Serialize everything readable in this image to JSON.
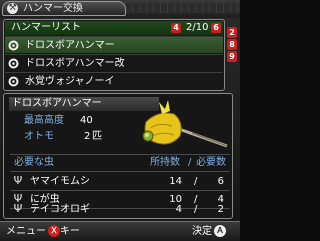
{
  "window": {
    "title": "ハンマー交換",
    "title_icon": "hammer-icon"
  },
  "list": {
    "header": "ハンマーリスト",
    "page_badge_left": "4",
    "count": "2/10",
    "page_badge_right": "6",
    "items": [
      {
        "label": "ドロスボアハンマー",
        "selected": true
      },
      {
        "label": "ドロスボアハンマー改",
        "selected": false
      },
      {
        "label": "水覚ヴォジャノーイ",
        "selected": false
      }
    ]
  },
  "side_tabs": [
    "2",
    "8",
    "9"
  ],
  "detail": {
    "name": "ドロスボアハンマー",
    "max_altitude_label": "最高高度",
    "max_altitude_value": "40",
    "otomo_label": "オトモ",
    "otomo_value": "2",
    "otomo_unit": "匹",
    "required_label": "必要な虫",
    "owned_label": "所持数",
    "slash": "/",
    "needed_label": "必要数",
    "bugs": [
      {
        "name": "ヤマイモムシ",
        "owned": "14",
        "needed": "6"
      },
      {
        "name": "にが虫",
        "owned": "10",
        "needed": "4"
      },
      {
        "name": "テイコオロギ",
        "owned": "4",
        "needed": "2"
      }
    ]
  },
  "footer": {
    "menu_label": "メニュー",
    "menu_key": "Ｘ",
    "menu_key_suffix": "キー",
    "confirm_label": "決定",
    "confirm_key": "Ａ"
  },
  "colors": {
    "accent_red": "#c8201e",
    "selected_row": "#3a5e33",
    "stat_label_blue": "#7fb2e8"
  }
}
